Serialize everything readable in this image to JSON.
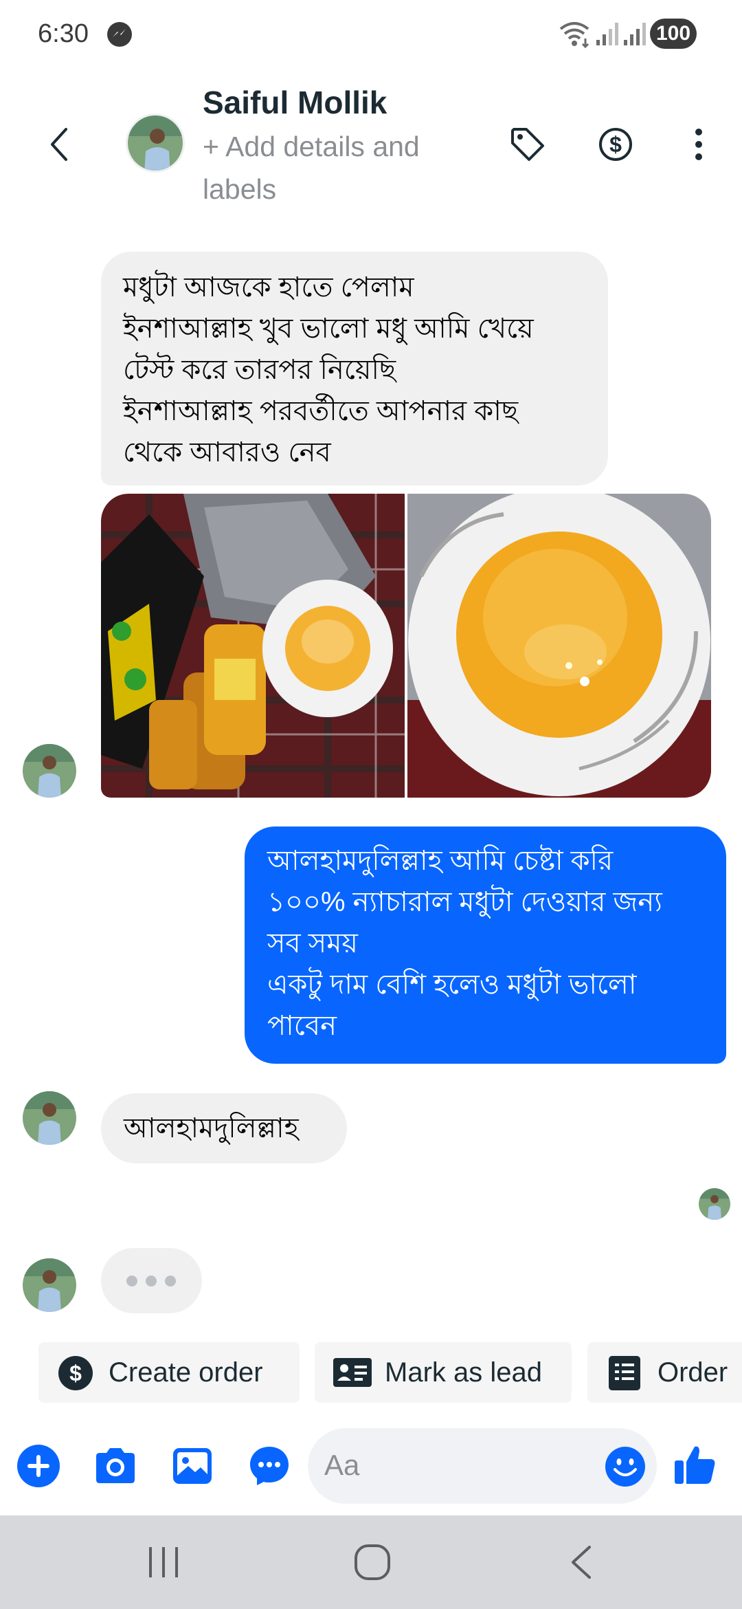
{
  "status_bar": {
    "time": "6:30",
    "battery": "100"
  },
  "header": {
    "contact_name": "Saiful Mollik",
    "add_details": "+ Add details and labels"
  },
  "messages": {
    "incoming_1": {
      "lines": [
        "মধুটা  আজকে হাতে পেলাম",
        "ইনশাআল্লাহ খুব ভালো মধু আমি খেয়ে",
        "টেস্ট করে তারপর নিয়েছি",
        "ইনশাআল্লাহ পরবর্তীতে আপনার কাছ",
        "থেকে আবারও নেব"
      ]
    },
    "outgoing_1": {
      "lines": [
        "আলহামদুলিল্লাহ আমি চেষ্টা করি",
        "১০০% ন্যাচারাল মধুটা দেওয়ার জন্য",
        "সব সময়",
        "একটু দাম বেশি হলেও মধুটা ভালো",
        "পাবেন"
      ]
    },
    "incoming_2": {
      "text": "আলহামদুলিল্লাহ"
    }
  },
  "quick_actions": {
    "create_order": "Create order",
    "mark_as_lead": "Mark as lead",
    "order": "Order"
  },
  "composer": {
    "placeholder": "Aa"
  },
  "colors": {
    "accent": "#0866ff",
    "incoming_bubble": "#f0f0f0",
    "nav_bar": "#d7d8dc"
  },
  "icons": {
    "back": "chevron-left-icon",
    "tag": "tag-icon",
    "dollar": "dollar-circle-icon",
    "more": "more-vertical-icon",
    "plus": "plus-circle-icon",
    "camera": "camera-icon",
    "gallery": "image-icon",
    "message_bubble": "chat-bubble-icon",
    "emoji": "emoji-icon",
    "like": "thumbs-up-icon"
  }
}
